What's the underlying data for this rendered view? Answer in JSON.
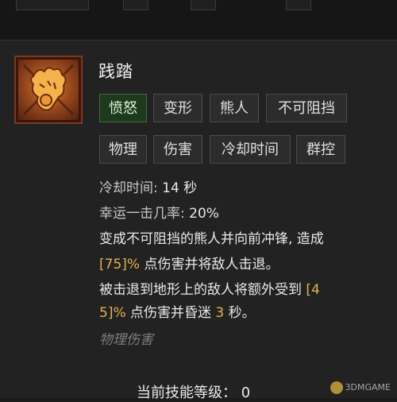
{
  "skill": {
    "icon": "bear-paw-icon",
    "title": "践踏"
  },
  "tags": [
    "愤怒",
    "变形",
    "熊人",
    "不可阻挡",
    "物理",
    "伤害",
    "冷却时间",
    "群控"
  ],
  "stats": {
    "cooldown_label": "冷却时间:",
    "cooldown_value": "14 秒",
    "lucky_label": "幸运一击几率:",
    "lucky_value": "20%"
  },
  "description": {
    "line1": "变成不可阻挡的熊人并向前冲锋, 造成",
    "line2_bracket": "[75]%",
    "line2_rest": " 点伤害并将敌人击退。",
    "line3_text": "被击退到地形上的敌人将额外受到 ",
    "line3_bracket": "[4",
    "line4_bracket": "5]%",
    "line4_mid": " 点伤害并昏迷 ",
    "line4_num": "3",
    "line4_end": " 秒。"
  },
  "damage_type": "物理伤害",
  "level": {
    "label": "当前技能等级：",
    "value": "0"
  },
  "watermark": "3DMGAME",
  "colors": {
    "background": "#222222",
    "active_tag_bg": "#1e3a1e",
    "highlight": "#e2b24a"
  }
}
